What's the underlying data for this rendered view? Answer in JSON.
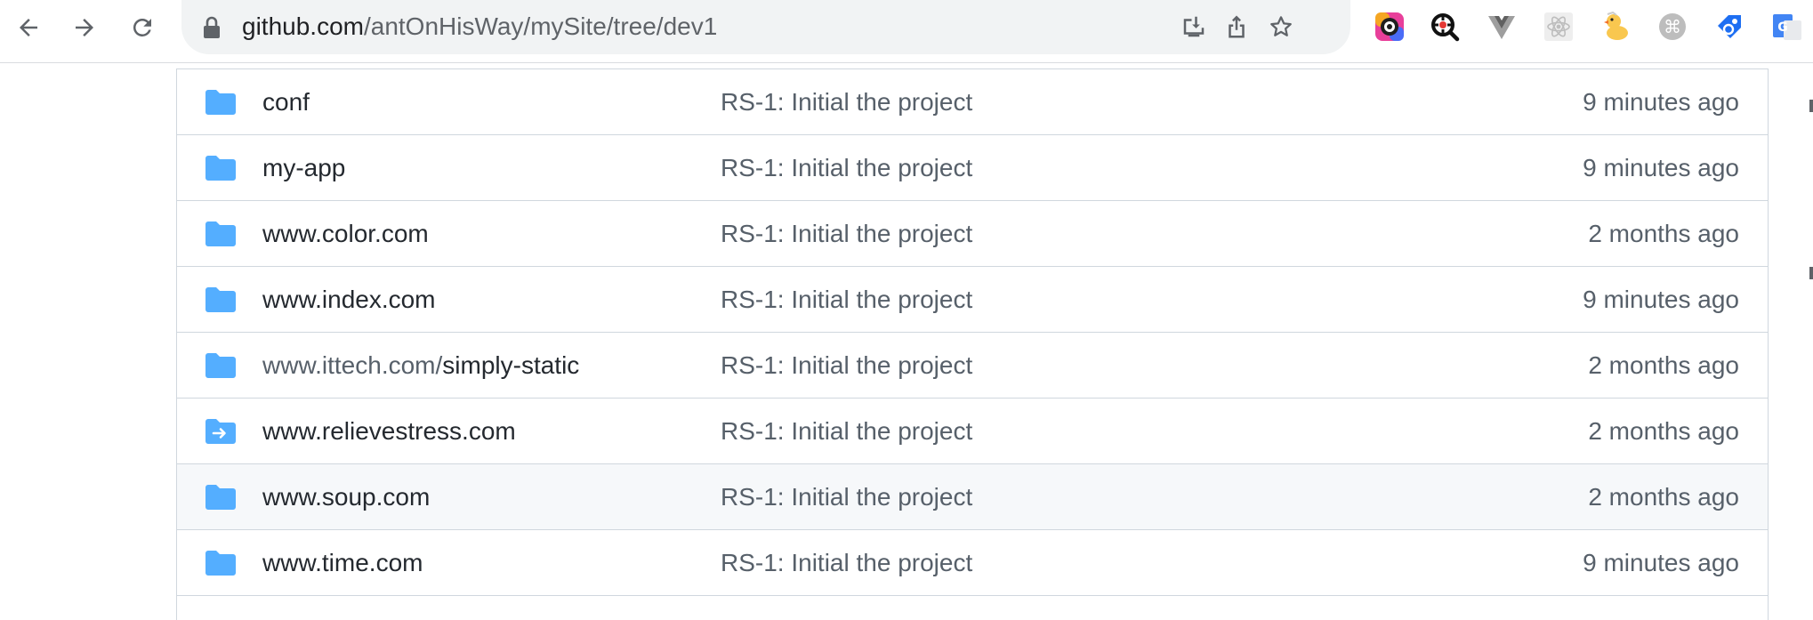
{
  "browser": {
    "url_host": "github.com",
    "url_path": "/antOnHisWay/mySite/tree/dev1",
    "nav_icons": [
      "back-arrow-icon",
      "forward-arrow-icon",
      "reload-icon"
    ],
    "omnibox_icons": [
      "install-app-icon",
      "share-icon",
      "bookmark-star-icon"
    ],
    "extensions": [
      "colorful-ring-extension-icon",
      "magnifier-q-extension-icon",
      "vue-devtools-extension-icon",
      "react-devtools-extension-icon",
      "duck-extension-icon",
      "command-key-extension-icon",
      "tag-extension-icon",
      "google-translate-extension-icon"
    ]
  },
  "files": {
    "rows": [
      {
        "name": "conf",
        "name_prefix": "",
        "message": "RS-1: Initial the project",
        "age": "9 minutes ago",
        "type": "folder"
      },
      {
        "name": "my-app",
        "name_prefix": "",
        "message": "RS-1: Initial the project",
        "age": "9 minutes ago",
        "type": "folder"
      },
      {
        "name": "www.color.com",
        "name_prefix": "",
        "message": "RS-1: Initial the project",
        "age": "2 months ago",
        "type": "folder"
      },
      {
        "name": "www.index.com",
        "name_prefix": "",
        "message": "RS-1: Initial the project",
        "age": "9 minutes ago",
        "type": "folder"
      },
      {
        "name": "simply-static",
        "name_prefix": "www.ittech.com/",
        "message": "RS-1: Initial the project",
        "age": "2 months ago",
        "type": "folder"
      },
      {
        "name": "www.relievestress.com",
        "name_prefix": "",
        "message": "RS-1: Initial the project",
        "age": "2 months ago",
        "type": "submodule"
      },
      {
        "name": "www.soup.com",
        "name_prefix": "",
        "message": "RS-1: Initial the project",
        "age": "2 months ago",
        "type": "folder"
      },
      {
        "name": "www.time.com",
        "name_prefix": "",
        "message": "RS-1: Initial the project",
        "age": "9 minutes ago",
        "type": "folder"
      }
    ]
  },
  "colors": {
    "folder_icon": "#54aeff",
    "hover_row": "#f6f8fa",
    "border": "#d0d7de"
  }
}
